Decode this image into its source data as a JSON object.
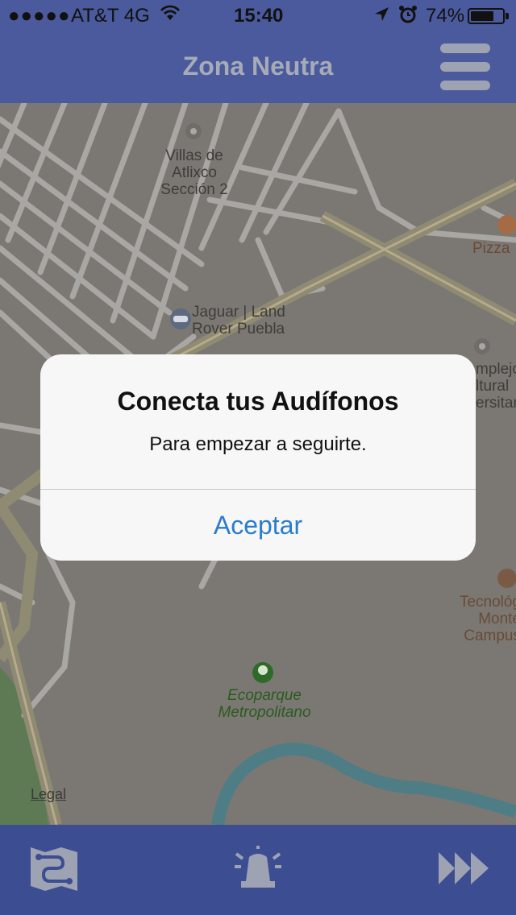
{
  "status_bar": {
    "signal": "●●●●●",
    "carrier": "AT&T 4G",
    "time": "15:40",
    "battery": "74%",
    "battery_level": 0.74,
    "icons": [
      "wifi-icon",
      "location-arrow-icon",
      "alarm-icon",
      "battery-icon"
    ]
  },
  "navbar": {
    "title": "Zona Neutra",
    "menu_icon": "hamburger-icon"
  },
  "map": {
    "labels": {
      "villas": "Villas de\nAtlixco\nSección 2",
      "jaguar": "Jaguar | Land\nRover Puebla",
      "pizza": "Pizza",
      "complejo": "mplejo\nltural\nersitar",
      "tec": "Tecnológ\nMonte\nCampus",
      "ecoparque": "Ecoparque\nMetropolitano"
    },
    "legal": "Legal",
    "colors": {
      "background": "#7b7873",
      "roads": "#a9a7a3",
      "highway": "#8f8a72",
      "river": "#4f7d86",
      "park": "#5e7a55"
    }
  },
  "alert": {
    "title": "Conecta tus Audífonos",
    "message": "Para empezar a seguirte.",
    "button": "Aceptar"
  },
  "tab_bar": {
    "icons": [
      "route-map-icon",
      "alarm-siren-icon",
      "fast-forward-icon"
    ]
  },
  "colors": {
    "bar": "#4a5a9c",
    "tabbar": "#3d4d92",
    "accent": "#2a7ccd"
  }
}
